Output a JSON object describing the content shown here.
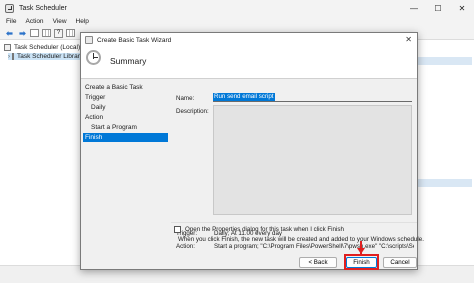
{
  "window": {
    "title": "Task Scheduler",
    "minimize": "—",
    "maximize": "☐",
    "close": "✕"
  },
  "menu": [
    "File",
    "Action",
    "View",
    "Help"
  ],
  "toolbar": {
    "back_icon": "back-arrow-icon",
    "forward_icon": "forward-arrow-icon"
  },
  "tree": {
    "root": "Task Scheduler (Local)",
    "library": "Task Scheduler Library"
  },
  "dialog": {
    "title": "Create Basic Task Wizard",
    "close": "✕",
    "header": "Summary",
    "steps": [
      "Create a Basic Task",
      "Trigger",
      "Daily",
      "Action",
      "Start a Program",
      "Finish"
    ],
    "active_step": "Finish",
    "name_label": "Name:",
    "name_value": "Run send email script",
    "description_label": "Description:",
    "trigger_label": "Trigger:",
    "trigger_value": "Daily; At 11.00 every day",
    "action_label": "Action:",
    "action_value": "Start a program; \"C:\\Program Files\\PowerShell\\7\\pwsh.exe\" \"C:\\scripts\\Send",
    "checkbox_label": "Open the Properties dialog for this task when I click Finish",
    "hint": "When you click Finish, the new task will be created and added to your Windows schedule.",
    "buttons": {
      "back": "< Back",
      "finish": "Finish",
      "cancel": "Cancel"
    }
  },
  "colors": {
    "accent": "#0078d7",
    "highlight_red": "#e01f1f"
  }
}
